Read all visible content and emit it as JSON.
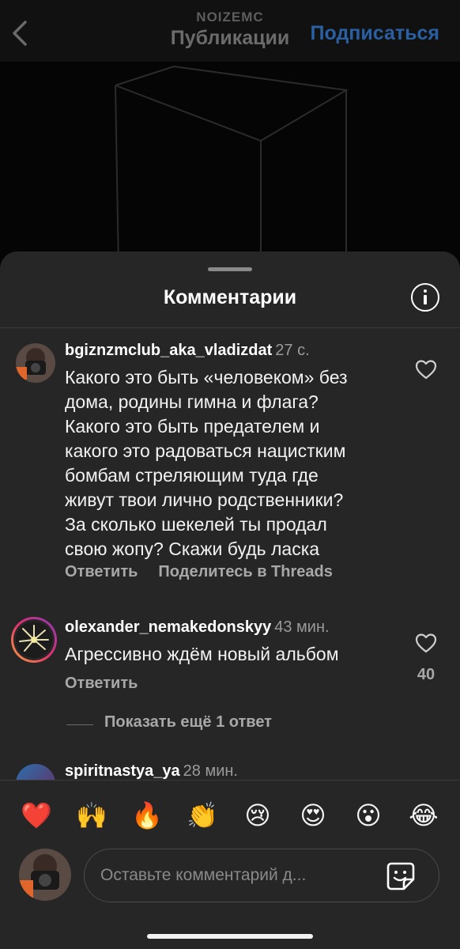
{
  "header": {
    "username": "NOIZEMC",
    "title": "Публикации",
    "follow_label": "Подписаться"
  },
  "sheet": {
    "title": "Комментарии"
  },
  "comments": [
    {
      "username": "bgiznzmclub_aka_vladizdat",
      "time": "27 с.",
      "text": "Какого это быть «человеком» без\nдома, родины гимна и флага?\nКакого это быть предателем и\nкакого это радоваться нацистким\nбомбам стреляющим туда где\nживут твои лично родственники?\nЗа сколько шекелей ты продал\nсвою жопу? Скажи будь ласка",
      "reply_label": "Ответить",
      "share_label": "Поделитесь в Threads"
    },
    {
      "username": "olexander_nemakedonskyy",
      "time": "43 мин.",
      "text": "Агрессивно ждём новый альбом",
      "reply_label": "Ответить",
      "likes": "40",
      "more_replies": "Показать ещё 1 ответ"
    },
    {
      "username": "spiritnastya_ya",
      "time": "28 мин."
    }
  ],
  "emoji_bar": [
    "❤️",
    "🙌",
    "🔥",
    "👏",
    "😢",
    "😍",
    "😮",
    "😂"
  ],
  "composer": {
    "placeholder": "Оставьте комментарий д..."
  },
  "colors": {
    "sheet_bg": "#262626",
    "follow_blue": "#2a5fa1",
    "secondary_text": "#a8a8a8"
  }
}
